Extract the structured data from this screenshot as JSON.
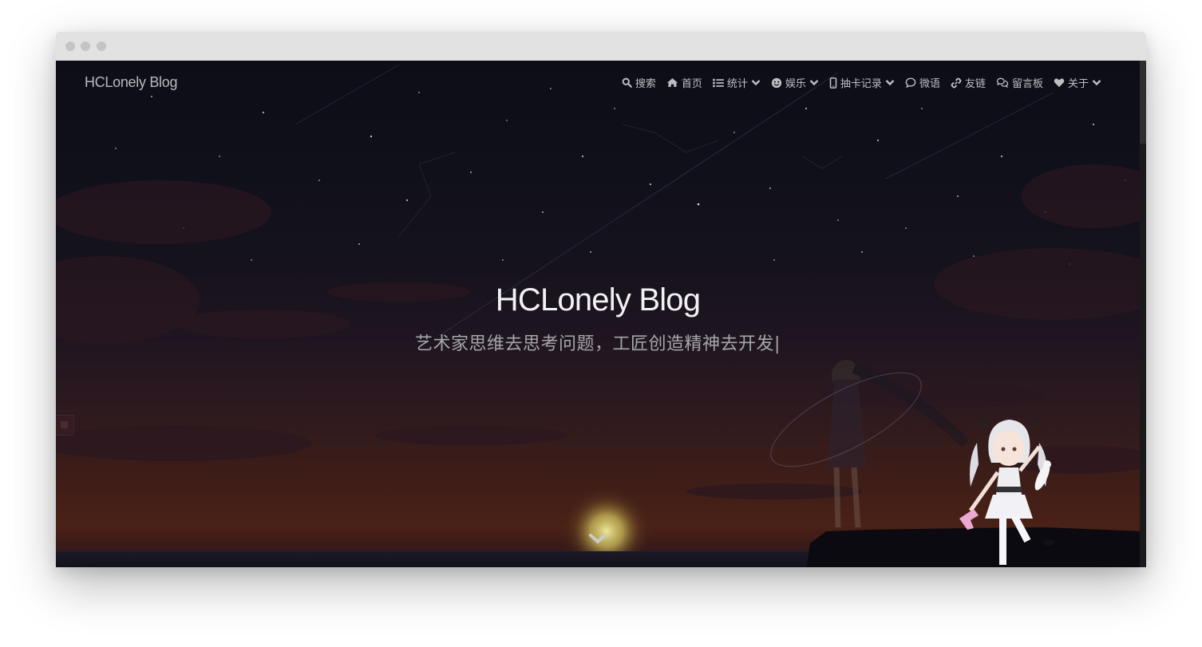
{
  "window": {
    "title_bar_dots": [
      "close",
      "minimize",
      "maximize"
    ]
  },
  "navbar": {
    "brand": "HCLonely Blog",
    "items": [
      {
        "label": "搜索",
        "icon": "search-icon",
        "has_dropdown": false
      },
      {
        "label": "首页",
        "icon": "home-icon",
        "has_dropdown": false
      },
      {
        "label": "统计",
        "icon": "list-icon",
        "has_dropdown": true
      },
      {
        "label": "娱乐",
        "icon": "smile-icon",
        "has_dropdown": true
      },
      {
        "label": "抽卡记录",
        "icon": "mobile-icon",
        "has_dropdown": true
      },
      {
        "label": "微语",
        "icon": "comment-icon",
        "has_dropdown": false
      },
      {
        "label": "友链",
        "icon": "link-icon",
        "has_dropdown": false
      },
      {
        "label": "留言板",
        "icon": "comments-icon",
        "has_dropdown": false
      },
      {
        "label": "关于",
        "icon": "heart-icon",
        "has_dropdown": true
      }
    ]
  },
  "hero": {
    "title": "HCLonely Blog",
    "subtitle": "艺术家思维去思考问题，工匠创造精神去开发|"
  },
  "colors": {
    "nav_text": "#bdbdc2",
    "hero_title": "#f2f2f4",
    "hero_subtitle": "#a6a6ab",
    "sky_top": "#0d0d17",
    "sunset": "#4a2116"
  }
}
